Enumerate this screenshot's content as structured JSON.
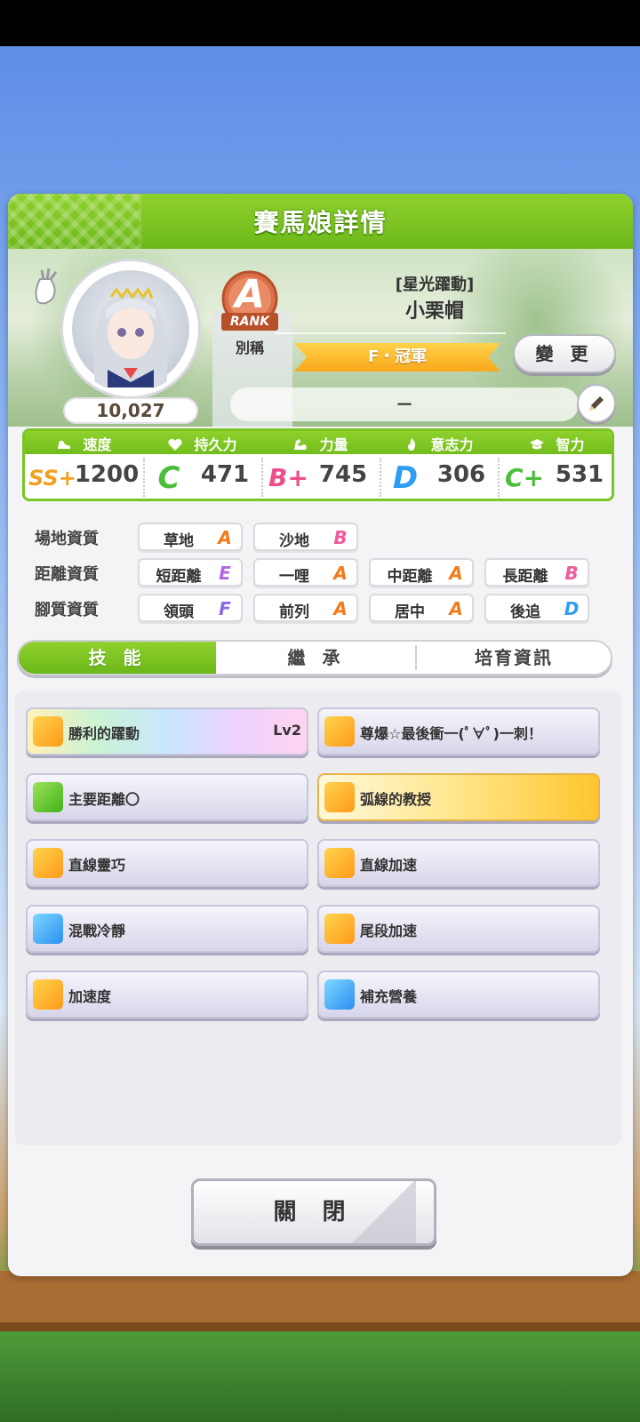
{
  "dialog": {
    "title": "賽馬娘詳情",
    "close_label": "關 閉"
  },
  "profile": {
    "fan_count": "10,027",
    "rank": {
      "letter": "A",
      "label": "RANK"
    },
    "nickname_label": "別稱",
    "epithet": "[星光躍動]",
    "name": "小栗帽",
    "title_ribbon": "F・冠軍",
    "change_label": "變 更",
    "nickname_value": "－"
  },
  "stats": [
    {
      "name": "速度",
      "icon": "shoe-icon",
      "grade": "SS+",
      "value": "1200",
      "color": "#f0a020"
    },
    {
      "name": "持久力",
      "icon": "heart-icon",
      "grade": "C",
      "value": "471",
      "color": "#4cbf3a"
    },
    {
      "name": "力量",
      "icon": "muscle-icon",
      "grade": "B+",
      "value": "745",
      "color": "#ee4f8a"
    },
    {
      "name": "意志力",
      "icon": "flame-icon",
      "grade": "D",
      "value": "306",
      "color": "#2f9ef0"
    },
    {
      "name": "智力",
      "icon": "graduation-cap-icon",
      "grade": "C+",
      "value": "531",
      "color": "#4cbf3a"
    }
  ],
  "aptitudes": {
    "track": {
      "label": "場地資質",
      "items": [
        {
          "name": "草地",
          "grade": "A"
        },
        {
          "name": "沙地",
          "grade": "B"
        }
      ]
    },
    "distance": {
      "label": "距離資質",
      "items": [
        {
          "name": "短距離",
          "grade": "E"
        },
        {
          "name": "一哩",
          "grade": "A"
        },
        {
          "name": "中距離",
          "grade": "A"
        },
        {
          "name": "長距離",
          "grade": "B"
        }
      ]
    },
    "style": {
      "label": "腳質資質",
      "items": [
        {
          "name": "領頭",
          "grade": "F"
        },
        {
          "name": "前列",
          "grade": "A"
        },
        {
          "name": "居中",
          "grade": "A"
        },
        {
          "name": "後追",
          "grade": "D"
        }
      ]
    }
  },
  "grade_colors": {
    "A": "#f47a1a",
    "B": "#ef5a9a",
    "C": "#4cbf3a",
    "D": "#2f9ef0",
    "E": "#b267e0",
    "F": "#8a6ae0"
  },
  "tabs": [
    {
      "label": "技 能",
      "active": true
    },
    {
      "label": "繼 承",
      "active": false
    },
    {
      "label": "培育資訊",
      "active": false
    }
  ],
  "skills": [
    {
      "name": "勝利的躍動",
      "level": "Lv2",
      "icon": "speed-skill-icon",
      "style": "rainbow"
    },
    {
      "name": "尊爆☆最後衝一(ﾟ∀ﾟ)一刺！",
      "level": "",
      "icon": "speed-skill-icon",
      "style": "normal"
    },
    {
      "name": "主要距離〇",
      "level": "",
      "icon": "heart-skill-icon",
      "style": "normal"
    },
    {
      "name": "弧線的教授",
      "level": "",
      "icon": "speed-skill-icon",
      "style": "gold"
    },
    {
      "name": "直線靈巧",
      "level": "",
      "icon": "speed-skill-icon",
      "style": "normal"
    },
    {
      "name": "直線加速",
      "level": "",
      "icon": "speed-skill-icon",
      "style": "normal"
    },
    {
      "name": "混戰冷靜",
      "level": "",
      "icon": "sparkle-skill-icon",
      "style": "normal"
    },
    {
      "name": "尾段加速",
      "level": "",
      "icon": "speed-skill-icon",
      "style": "normal"
    },
    {
      "name": "加速度",
      "level": "",
      "icon": "speed-skill-icon",
      "style": "normal"
    },
    {
      "name": "補充營養",
      "level": "",
      "icon": "sparkle-skill-icon",
      "style": "normal"
    }
  ]
}
